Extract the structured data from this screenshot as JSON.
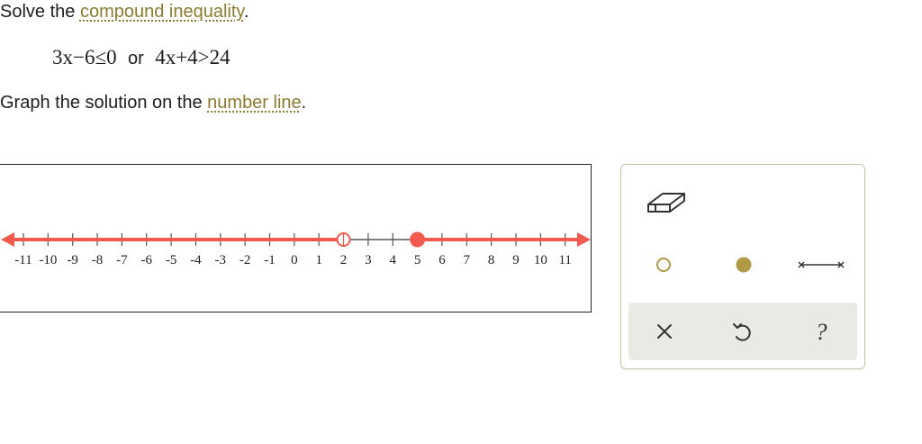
{
  "instructions": {
    "line1_prefix": "Solve the ",
    "line1_link": "compound inequality",
    "line1_suffix": ".",
    "line3_prefix": "Graph the solution on the ",
    "line3_link": "number line",
    "line3_suffix": "."
  },
  "expression": {
    "left": "3x−6≤0",
    "connector": "or",
    "right": "4x+4>24"
  },
  "number_line": {
    "min": -11,
    "max": 11,
    "tick_labels": [
      "-11",
      "-10",
      "-9",
      "-8",
      "-7",
      "-6",
      "-5",
      "-4",
      "-3",
      "-2",
      "-1",
      "0",
      "1",
      "2",
      "3",
      "4",
      "5",
      "6",
      "7",
      "8",
      "9",
      "10",
      "11"
    ],
    "shaded_left_to": 2,
    "open_point": 2,
    "closed_point": 5,
    "shaded_right_from": 5,
    "shade_color": "#f05a4f",
    "line_color": "#555555"
  },
  "toolbox": {
    "tools": [
      "eraser-icon",
      "open-circle-icon",
      "closed-circle-icon",
      "segment-icon"
    ],
    "actions": [
      "clear-icon",
      "undo-icon",
      "help-icon"
    ],
    "accent_color": "#b09a45",
    "help_symbol": "?"
  }
}
